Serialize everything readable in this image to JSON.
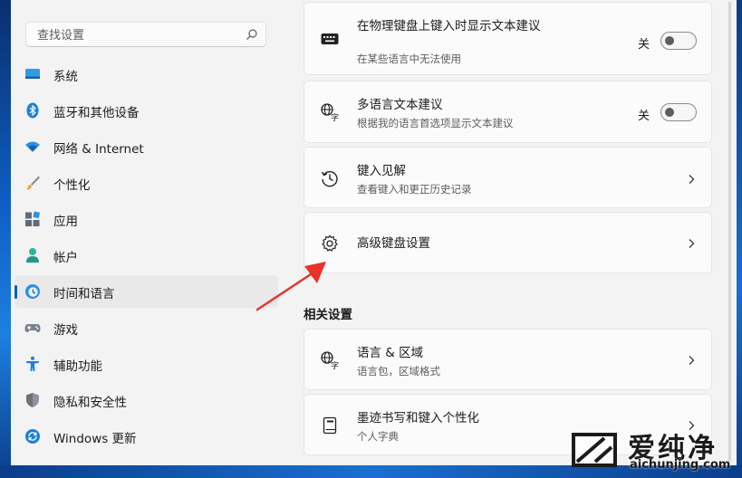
{
  "search": {
    "placeholder": "查找设置"
  },
  "sidebar": {
    "items": [
      {
        "label": "系统",
        "icon": "system-icon"
      },
      {
        "label": "蓝牙和其他设备",
        "icon": "bluetooth-icon"
      },
      {
        "label": "网络 & Internet",
        "icon": "wifi-icon"
      },
      {
        "label": "个性化",
        "icon": "brush-icon"
      },
      {
        "label": "应用",
        "icon": "apps-icon"
      },
      {
        "label": "帐户",
        "icon": "account-icon"
      },
      {
        "label": "时间和语言",
        "icon": "time-language-icon",
        "selected": true
      },
      {
        "label": "游戏",
        "icon": "gamepad-icon"
      },
      {
        "label": "辅助功能",
        "icon": "accessibility-icon"
      },
      {
        "label": "隐私和安全性",
        "icon": "shield-icon"
      },
      {
        "label": "Windows 更新",
        "icon": "update-icon"
      }
    ]
  },
  "main": {
    "cards": [
      {
        "title": "在物理键盘上键入时显示文本建议",
        "subtitle": "在某些语言中无法使用",
        "state": "关",
        "icon": "keyboard-icon"
      },
      {
        "title": "多语言文本建议",
        "subtitle": "根据我的语言首选项显示文本建议",
        "state": "关",
        "icon": "language-icon"
      },
      {
        "title": "键入见解",
        "subtitle": "查看键入和更正历史记录",
        "icon": "history-icon"
      },
      {
        "title": "高级键盘设置",
        "icon": "gear-icon"
      }
    ],
    "related_title": "相关设置",
    "related": [
      {
        "title": "语言 & 区域",
        "subtitle": "语言包，区域格式",
        "icon": "language-icon"
      },
      {
        "title": "墨迹书写和键入个性化",
        "subtitle": "个人字典",
        "icon": "dictionary-icon"
      }
    ]
  },
  "watermark": {
    "brand": "爱纯净",
    "url": "aichunjing.com"
  },
  "colors": {
    "accent": "#005fb8",
    "arrow": "#e8322a",
    "background": "#f3f3f3",
    "card": "#fbfbfb"
  }
}
